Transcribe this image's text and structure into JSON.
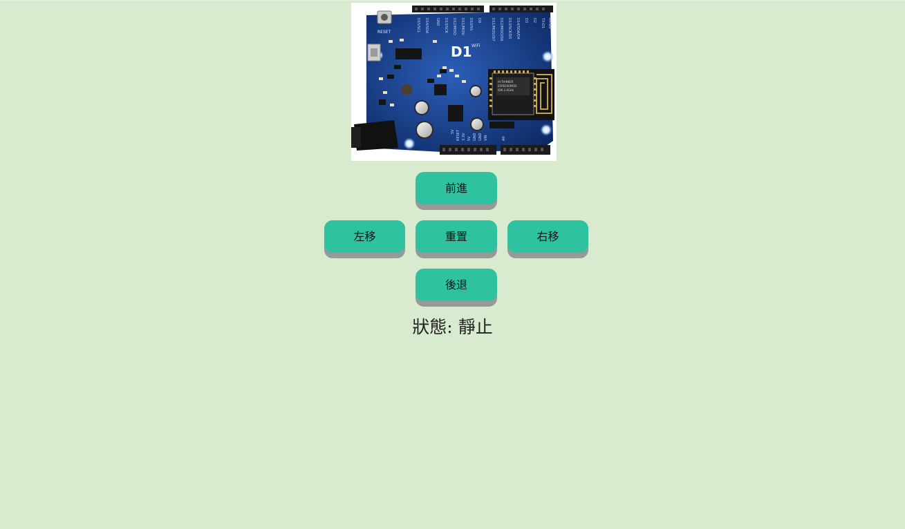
{
  "board_image": {
    "icon": "wemos-d1-board-photo",
    "board_label": "D1",
    "reset_label": "RESET",
    "wifi_label": "WiFi"
  },
  "controls": {
    "forward_label": "前進",
    "left_label": "左移",
    "reset_label": "重置",
    "right_label": "右移",
    "backward_label": "後退"
  },
  "status": {
    "prefix": "狀態:",
    "value": "靜止"
  },
  "colors": {
    "background": "#d9ebcf",
    "button": "#2ec2a1",
    "button_shadow": "#999999",
    "board_pcb": "#1a3f86"
  }
}
